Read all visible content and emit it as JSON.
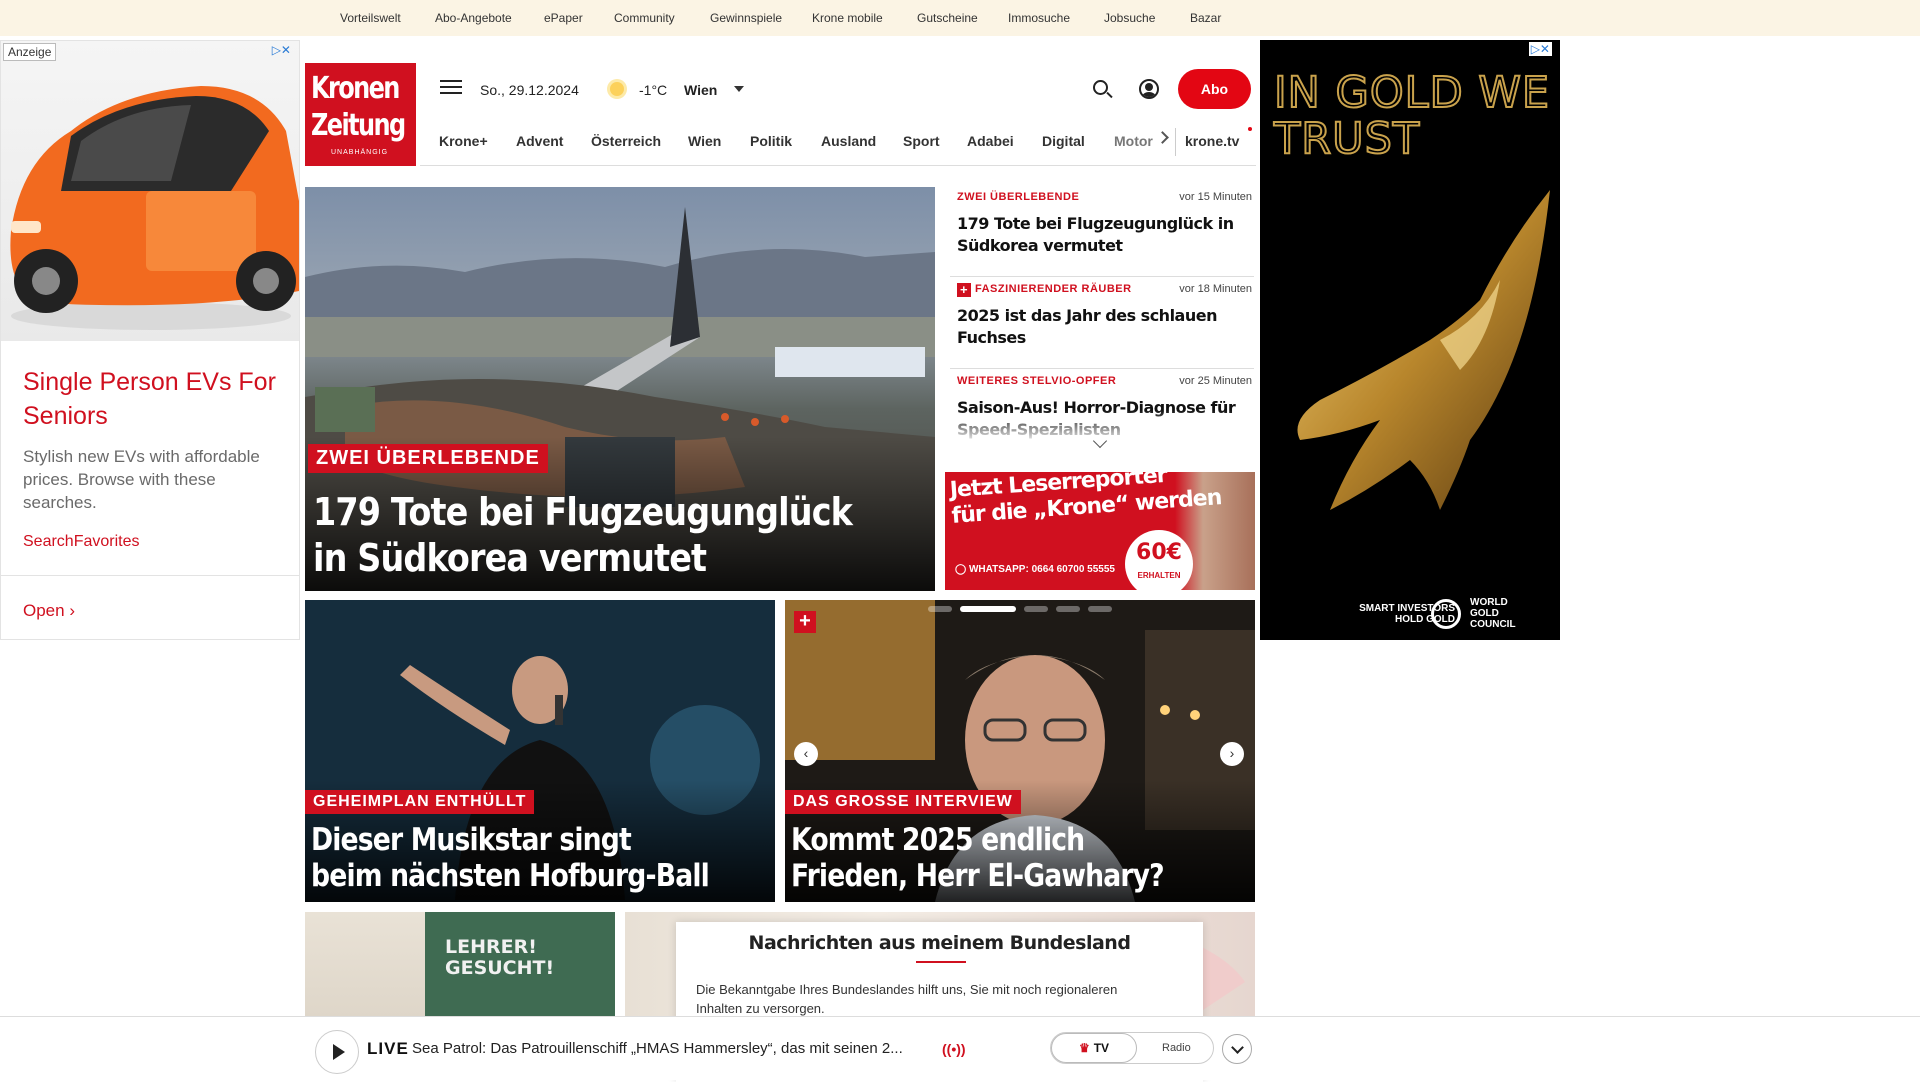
{
  "topnav": [
    "Vorteilswelt",
    "Abo-Angebote",
    "ePaper",
    "Community",
    "Gewinnspiele",
    "Krone mobile",
    "Gutscheine",
    "Immosuche",
    "Jobsuche",
    "Bazar"
  ],
  "left_ad": {
    "label": "Anzeige",
    "title": "Single Person EVs For Seniors",
    "desc": "Stylish new EVs with affordable prices. Browse with these searches.",
    "source": "SearchFavorites",
    "cta": "Open"
  },
  "right_ad": {
    "slogan": "IN GOLD WE TRUST",
    "footer_left": "SMART INVESTORS HOLD GOLD",
    "footer_right": "WORLD GOLD COUNCIL"
  },
  "header": {
    "logo_line1": "Kronen",
    "logo_line2": "Zeitung",
    "logo_tagline": "UNABHÄNGIG",
    "date": "So., 29.12.2024",
    "temperature": "-1°C",
    "city": "Wien",
    "abo_label": "Abo"
  },
  "nav": [
    "Krone+",
    "Advent",
    "Österreich",
    "Wien",
    "Politik",
    "Ausland",
    "Sport",
    "Adabei",
    "Digital",
    "Motor"
  ],
  "nav_tv": "krone.tv",
  "hero": {
    "kicker": "ZWEI ÜBERLEBENDE",
    "headline_l1": "179 Tote bei Flugzeugunglück",
    "headline_l2": "in Südkorea vermutet"
  },
  "newslist": [
    {
      "kicker": "ZWEI ÜBERLEBENDE",
      "time": "vor 15 Minuten",
      "headline": "179 Tote bei Flugzeugunglück in Südkorea vermutet",
      "plus": ""
    },
    {
      "kicker": "FASZINIERENDER RÄUBER",
      "time": "vor 18 Minuten",
      "headline": "2025 ist das Jahr des schlauen Fuchses",
      "plus": "+"
    },
    {
      "kicker": "WEITERES STELVIO-OPFER",
      "time": "vor 25 Minuten",
      "headline": "Saison-Aus! Horror-Diagnose für Speed-Spezialisten",
      "plus": ""
    }
  ],
  "reporter_ad": {
    "line1": "Jetzt Leserreporter",
    "line2": "für die „Krone“ werden",
    "whatsapp": "WHATSAPP: 0664 60700 55555",
    "amount": "60€",
    "amount_sub": "ERHALTEN"
  },
  "teasers": [
    {
      "kicker": "GEHEIMPLAN ENTHÜLLT",
      "l1": "Dieser Musikstar singt",
      "l2": "beim nächsten Hofburg-Ball"
    },
    {
      "kicker": "DAS GROSSE INTERVIEW",
      "l1": "Kommt 2025 endlich",
      "l2": "Frieden, Herr El-Gawhary?"
    }
  ],
  "lower": {
    "board_l1": "LEHRER!",
    "board_l2": "GESUCHT!",
    "popup_title": "Nachrichten aus meinem Bundesland",
    "popup_text": "Die Bekanntgabe Ihres Bundeslandes hilft uns, Sie mit noch regionaleren Inhalten zu versorgen."
  },
  "livebar": {
    "live": "LIVE",
    "text": "Sea Patrol: Das Patrouillenschiff „HMAS Hammersley“, das mit seinen 2...",
    "tv": "TV",
    "radio": "Radio"
  },
  "colors": {
    "brand_red": "#d0101f",
    "abo_red": "#e30613",
    "topbar_bg": "#fbf4e4",
    "gold": "#c9a24c"
  }
}
